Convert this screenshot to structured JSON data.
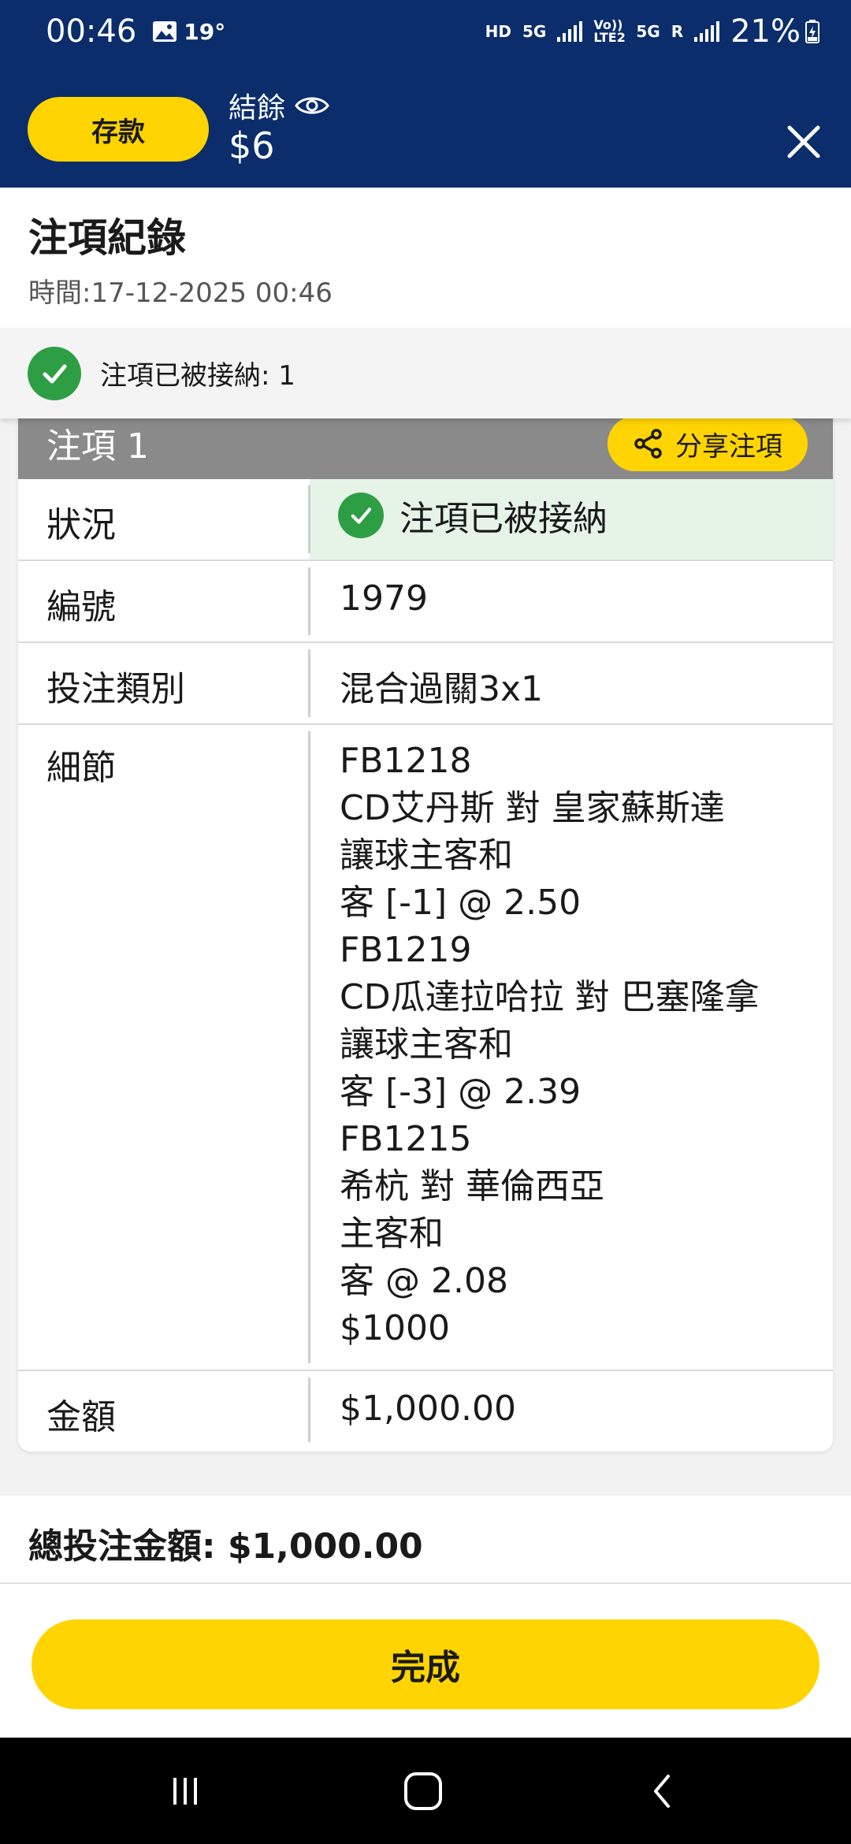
{
  "status_bar": {
    "time": "00:46",
    "temperature": "19°",
    "network_hd": "HD",
    "network_5g": "5G",
    "volte_label": "Vo)) LTE2",
    "network_5g_2": "5G",
    "roaming": "R",
    "battery": "21%"
  },
  "header": {
    "deposit_label": "存款",
    "balance_label": "結餘",
    "balance_value": "$6"
  },
  "title": {
    "text": "注項紀錄",
    "time": "時間:17-12-2025 00:46"
  },
  "banner": {
    "text": "注項已被接納: 1"
  },
  "bet": {
    "header": "注項 1",
    "share_label": "分享注項",
    "rows": {
      "status_label": "狀況",
      "status_value": "注項已被接納",
      "id_label": "編號",
      "id_value": "1979",
      "type_label": "投注類別",
      "type_value": "混合過關3x1",
      "detail_label": "細節",
      "detail_lines": [
        "FB1218",
        "CD艾丹斯 對 皇家蘇斯達",
        "讓球主客和",
        "客 [-1] @ 2.50",
        "FB1219",
        "CD瓜達拉哈拉 對 巴塞隆拿",
        "讓球主客和",
        "客 [-3] @ 2.39",
        "FB1215",
        "希杭 對 華倫西亞",
        "主客和",
        "客 @ 2.08",
        "$1000"
      ],
      "amount_label": "金額",
      "amount_value": "$1,000.00"
    }
  },
  "total": {
    "label": "總投注金額:",
    "value": "$1,000.00"
  },
  "done_label": "完成",
  "colors": {
    "header_bg": "#0b2d6b",
    "accent_yellow": "#ffd400",
    "success_green": "#2e9e45",
    "card_header_gray": "#8a8a8a"
  },
  "icons": [
    "image-icon",
    "eye-icon",
    "close-icon",
    "check-icon",
    "share-icon",
    "recent-apps-icon",
    "home-icon",
    "back-icon"
  ]
}
